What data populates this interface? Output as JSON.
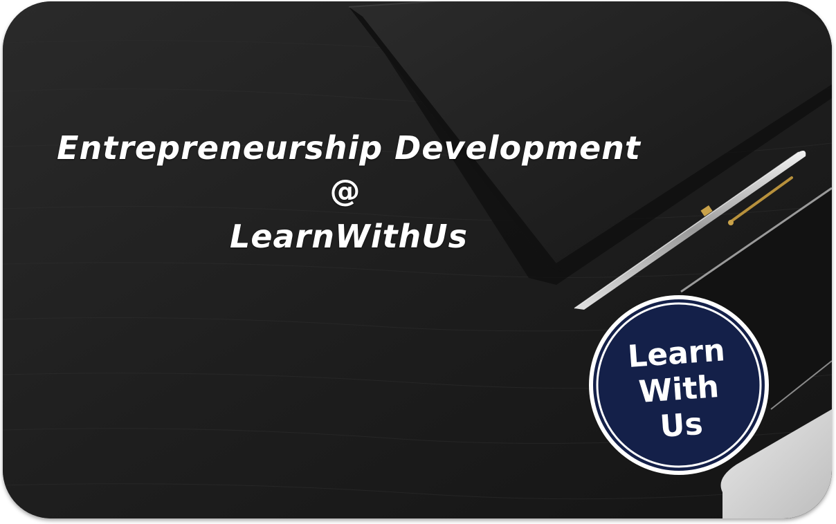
{
  "title": {
    "line1": "Entrepreneurship Development",
    "at": "@",
    "brand": "LearnWithUs"
  },
  "logo": {
    "line1": "Learn",
    "line2": "With",
    "line3": "Us",
    "fill_color": "#142049",
    "ring_color": "#ffffff"
  },
  "colors": {
    "background": "#1f1f1f",
    "text": "#ffffff"
  }
}
